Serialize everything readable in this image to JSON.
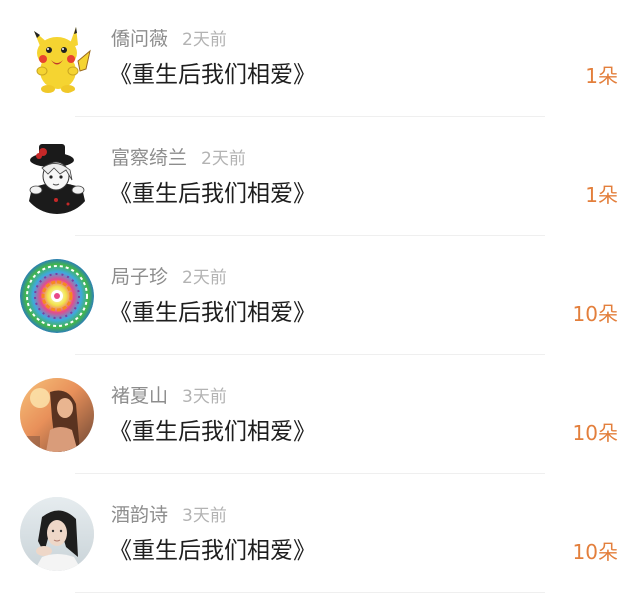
{
  "gift_list": {
    "items": [
      {
        "name": "僑问薇",
        "time": "2天前",
        "title": "《重生后我们相爱》",
        "amount": "1朵",
        "avatar_icon": "pikachu-avatar-icon"
      },
      {
        "name": "富察绮兰",
        "time": "2天前",
        "title": "《重生后我们相爱》",
        "amount": "1朵",
        "avatar_icon": "anime-boy-avatar-icon"
      },
      {
        "name": "局子珍",
        "time": "2天前",
        "title": "《重生后我们相爱》",
        "amount": "10朵",
        "avatar_icon": "mandala-avatar-icon"
      },
      {
        "name": "褚夏山",
        "time": "3天前",
        "title": "《重生后我们相爱》",
        "amount": "10朵",
        "avatar_icon": "sunset-girl-avatar-icon"
      },
      {
        "name": "酒韵诗",
        "time": "3天前",
        "title": "《重生后我们相爱》",
        "amount": "10朵",
        "avatar_icon": "girl-portrait-avatar-icon"
      }
    ]
  },
  "colors": {
    "name": "#8d8d8d",
    "time": "#b3b3b3",
    "title": "#1e1e1e",
    "amount": "#e37f3c",
    "divider": "#efefef"
  }
}
